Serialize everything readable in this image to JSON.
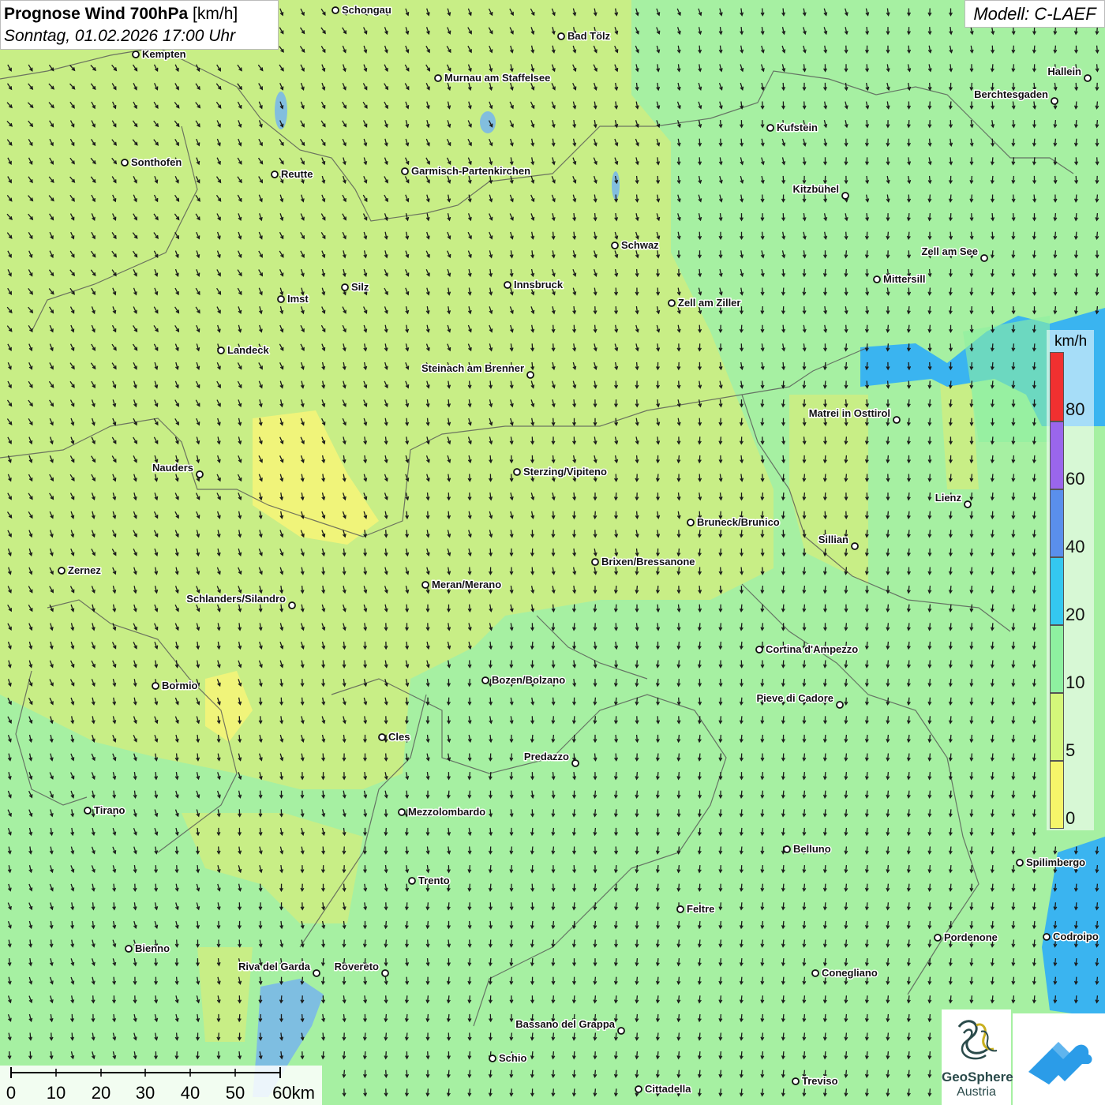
{
  "title": {
    "main": "Prognose Wind 700hPa",
    "unit": "[km/h]",
    "datetime": "Sonntag, 01.02.2026 17:00 Uhr"
  },
  "model": "Modell: C-LAEF",
  "legend": {
    "unit": "km/h",
    "classes": [
      {
        "label": "0",
        "color": "#f5f56a"
      },
      {
        "label": "5",
        "color": "#d4f77a"
      },
      {
        "label": "10",
        "color": "#8ef0a0"
      },
      {
        "label": "20",
        "color": "#34c8f0"
      },
      {
        "label": "40",
        "color": "#5a8fec"
      },
      {
        "label": "60",
        "color": "#9a66ec"
      },
      {
        "label": "80",
        "color": "#f03030"
      }
    ]
  },
  "scale_bar": {
    "labels": [
      "0",
      "10",
      "20",
      "30",
      "40",
      "50",
      "60km"
    ]
  },
  "cities": [
    {
      "name": "Schongau"
    },
    {
      "name": "Bad Tölz"
    },
    {
      "name": "Kempten"
    },
    {
      "name": "Murnau am Staffelsee"
    },
    {
      "name": "Hallein"
    },
    {
      "name": "Berchtesgaden"
    },
    {
      "name": "Kufstein"
    },
    {
      "name": "Sonthofen"
    },
    {
      "name": "Reutte"
    },
    {
      "name": "Garmisch-Partenkirchen"
    },
    {
      "name": "Kitzbühel"
    },
    {
      "name": "Schwaz"
    },
    {
      "name": "Zell am See"
    },
    {
      "name": "Mittersill"
    },
    {
      "name": "Silz"
    },
    {
      "name": "Innsbruck"
    },
    {
      "name": "Imst"
    },
    {
      "name": "Zell am Ziller"
    },
    {
      "name": "Landeck"
    },
    {
      "name": "Steinach am Brenner"
    },
    {
      "name": "Matrei in Osttirol"
    },
    {
      "name": "Nauders"
    },
    {
      "name": "Sterzing/Vipiteno"
    },
    {
      "name": "Lienz"
    },
    {
      "name": "Bruneck/Brunico"
    },
    {
      "name": "Sillian"
    },
    {
      "name": "Brixen/Bressanone"
    },
    {
      "name": "Zernez"
    },
    {
      "name": "Meran/Merano"
    },
    {
      "name": "Schlanders/Silandro"
    },
    {
      "name": "Cortina d'Ampezzo"
    },
    {
      "name": "Bozen/Bolzano"
    },
    {
      "name": "Bormio"
    },
    {
      "name": "Pieve di Cadore"
    },
    {
      "name": "Cles"
    },
    {
      "name": "Predazzo"
    },
    {
      "name": "Tirano"
    },
    {
      "name": "Mezzolombardo"
    },
    {
      "name": "Belluno"
    },
    {
      "name": "Spilimbergo"
    },
    {
      "name": "Trento"
    },
    {
      "name": "Feltre"
    },
    {
      "name": "Bienno"
    },
    {
      "name": "Pordenone"
    },
    {
      "name": "Codroipo"
    },
    {
      "name": "Riva del Garda"
    },
    {
      "name": "Rovereto"
    },
    {
      "name": "Conegliano"
    },
    {
      "name": "Bassano del Grappa"
    },
    {
      "name": "Schio"
    },
    {
      "name": "Treviso"
    },
    {
      "name": "Cittadella"
    }
  ],
  "logos": {
    "geosphere_line1": "GeoSphere",
    "geosphere_line2": "Austria"
  }
}
